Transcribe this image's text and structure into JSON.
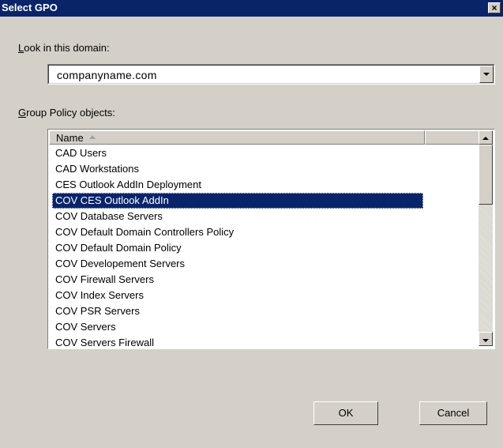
{
  "window": {
    "title": "Select GPO",
    "close_glyph": "×"
  },
  "domain": {
    "label_accel": "L",
    "label_rest": "ook in this domain:",
    "value": "companyname.com"
  },
  "gpo": {
    "label_accel": "G",
    "label_rest": "roup Policy objects:",
    "column_header": "Name",
    "selected_index": 3,
    "items": [
      "CAD Users",
      "CAD Workstations",
      "CES Outlook AddIn Deployment",
      "COV CES Outlook AddIn",
      "COV Database Servers",
      "COV Default Domain Controllers Policy",
      "COV Default Domain Policy",
      "COV Developement Servers",
      "COV Firewall Servers",
      "COV Index Servers",
      "COV PSR Servers",
      "COV Servers",
      "COV Servers Firewall"
    ]
  },
  "buttons": {
    "ok": "OK",
    "cancel": "Cancel"
  },
  "colors": {
    "title_bar": "#0a246a",
    "selection": "#0a246a",
    "dialog": "#d4d0c8"
  }
}
